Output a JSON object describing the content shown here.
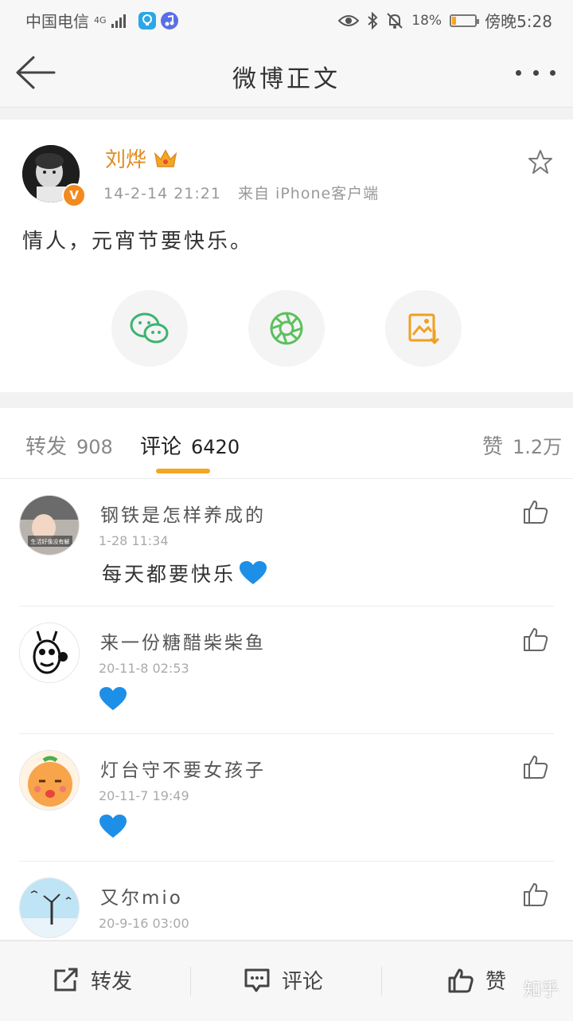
{
  "status_bar": {
    "carrier": "中国电信",
    "network": "4G",
    "battery": "18%",
    "battery_level": 0.18,
    "time": "傍晚5:28"
  },
  "nav": {
    "title": "微博正文"
  },
  "post": {
    "author": "刘烨",
    "time": "14-2-14 21:21",
    "source": "来自 iPhone客户端",
    "text": "情人，元宵节要快乐。",
    "share_buttons": [
      "wechat-icon",
      "moments-icon",
      "save-image-icon"
    ]
  },
  "tabs": {
    "repost_label": "转发",
    "repost_count": "908",
    "comment_label": "评论",
    "comment_count": "6420",
    "like_label": "赞",
    "like_count": "1.2万"
  },
  "comments": [
    {
      "name": "钢铁是怎样养成的",
      "time": "1-28 11:34",
      "text": "每天都要快乐",
      "heart": true,
      "avatar_caption": "生活好像没有解"
    },
    {
      "name": "来一份糖醋柴柴鱼",
      "time": "20-11-8 02:53",
      "text": "",
      "heart": true
    },
    {
      "name": "灯台守不要女孩子",
      "time": "20-11-7 19:49",
      "text": "",
      "heart": true
    },
    {
      "name": "又尔mio",
      "time": "20-9-16 03:00",
      "text": "",
      "heart": false
    }
  ],
  "bottom_bar": {
    "repost": "转发",
    "comment": "评论",
    "like": "赞"
  },
  "watermark": "知乎"
}
